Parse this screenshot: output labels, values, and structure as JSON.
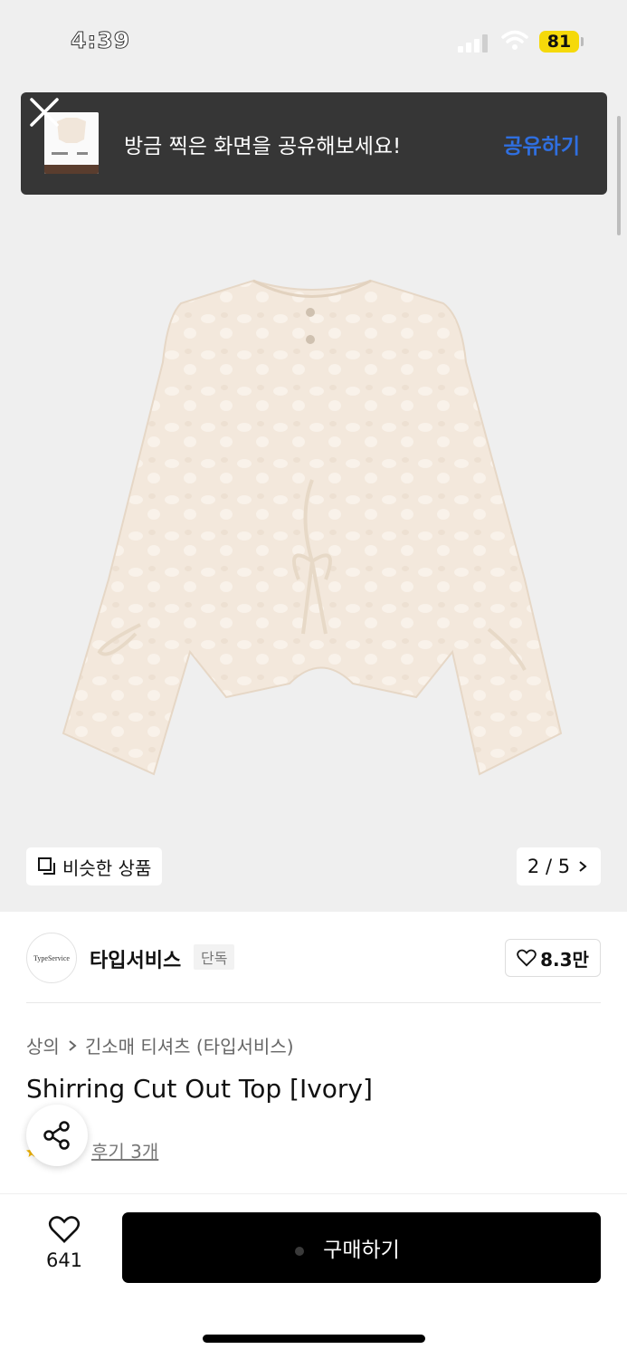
{
  "status": {
    "time": "4:39",
    "battery": "81"
  },
  "banner": {
    "message": "방금 찍은 화면을 공유해보세요!",
    "action": "공유하기"
  },
  "gallery": {
    "similar_label": "비슷한 상품",
    "page_counter": "2 / 5"
  },
  "brand": {
    "logo_text": "TypeService",
    "name": "타입서비스",
    "tag": "단독",
    "likes": "8.3만"
  },
  "breadcrumb": {
    "level1": "상의",
    "level2": "긴소매 티셔츠 (타입서비스)"
  },
  "product": {
    "title": "Shirring Cut Out Top [Ivory]",
    "reviews": "후기 3개"
  },
  "bottom": {
    "wish_count": "641",
    "buy_label": "구매하기"
  },
  "colors": {
    "accent": "#2f6fe0",
    "buy_button": "#000000",
    "banner_bg": "#363636",
    "battery": "#f5d90a"
  },
  "icons": [
    "close-icon",
    "heart-icon",
    "share-icon",
    "similar-icon",
    "chevron-right-icon",
    "wifi-icon",
    "signal-icon"
  ]
}
